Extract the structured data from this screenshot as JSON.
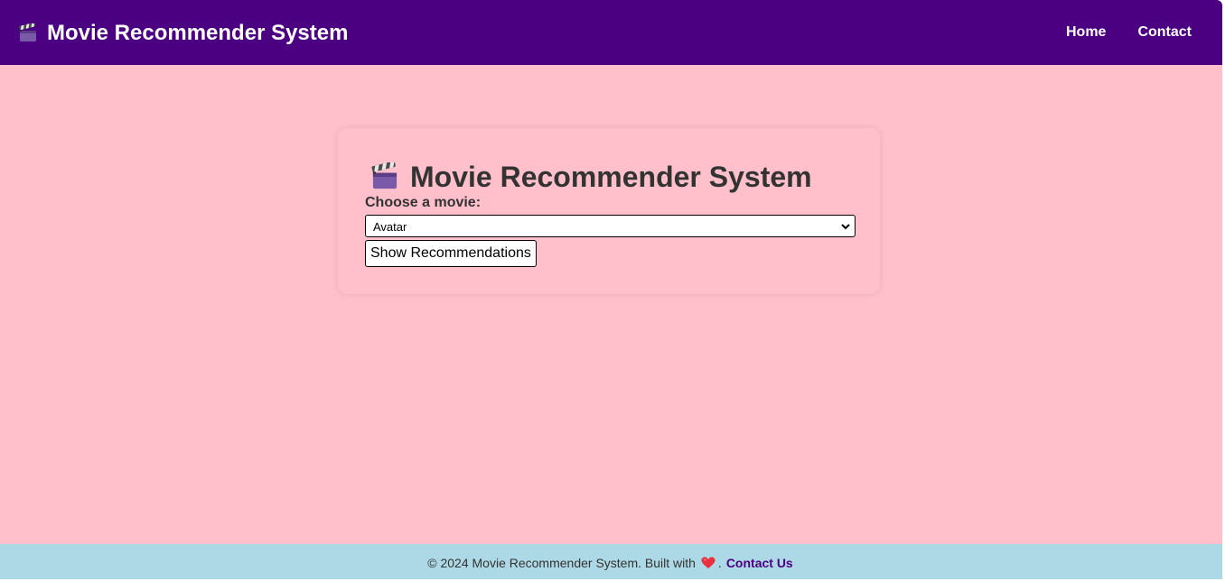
{
  "navbar": {
    "brand": "Movie Recommender System",
    "links": [
      {
        "label": "Home"
      },
      {
        "label": "Contact"
      }
    ]
  },
  "main": {
    "title": "Movie Recommender System",
    "select_label": "Choose a movie:",
    "selected_movie": "Avatar",
    "button_label": "Show Recommendations"
  },
  "footer": {
    "text_before": "© 2024 Movie Recommender System. Built with",
    "text_after": ".",
    "link_label": "Contact Us"
  },
  "icons": {
    "brand": "clapper-board-icon",
    "title": "clapper-board-icon",
    "select": "chevron-down-icon",
    "footer": "heart-icon"
  },
  "colors": {
    "navbar_bg": "#4b0082",
    "page_bg": "#ffc0cb",
    "footer_bg": "#add8e6",
    "link_color": "#4b0082",
    "heart": "#e8303f"
  }
}
